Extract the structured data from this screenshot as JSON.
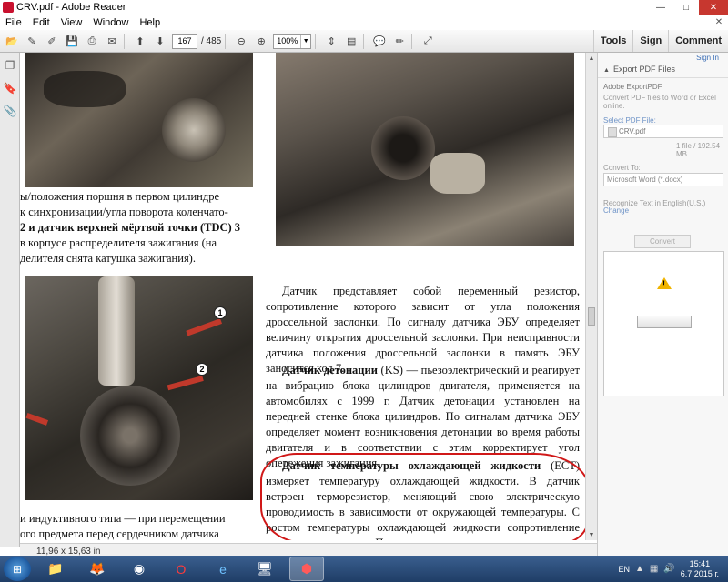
{
  "window": {
    "title": "CRV.pdf - Adobe Reader",
    "controls": {
      "minimize": "—",
      "maximize": "□",
      "close": "✕"
    }
  },
  "menu": {
    "items": [
      "File",
      "Edit",
      "View",
      "Window",
      "Help"
    ],
    "close_doc": "✕"
  },
  "toolbar": {
    "page_current": "167",
    "page_total": "/ 485",
    "zoom": "100%",
    "tools_label": "Tools",
    "sign_label": "Sign",
    "comment_label": "Comment"
  },
  "document": {
    "left_text_top": [
      "ы/положения поршня в первом цилиндре",
      "к синхронизации/угла поворота коленчато-",
      "2 и датчик верхней мёртвой точки (TDC) 3",
      "в корпусе распределителя зажигания (на",
      "делителя снята катушка зажигания)."
    ],
    "callout_1": "1",
    "callout_2": "2",
    "left_text_bottom": [
      "и индуктивного типа — при перемещении",
      "ого предмета перед сердечником датчика"
    ],
    "right_paragraphs": [
      "Датчик представляет собой переменный резистор, сопротивление которого зависит от угла положения дроссельной заслонки. По сигналу датчика ЭБУ определяет величину открытия дроссельной заслонки. При неисправности датчика положения дроссельной заслонки в память ЭБУ заносится код 7.",
      "Датчик детонации (KS) — пьезоэлектрический и реагирует на вибрацию блока цилиндров двигателя, применяется на автомобилях с 1999 г. Датчик детонации установлен на передней стенке блока цилиндров. По сигналам датчика ЭБУ определяет момент возникновения детонации во время работы двигателя и в соответствии с этим корректирует угол опережения зажигания.",
      "Датчик температуры охлаждающей жидкости (ECT) измеряет температуру охлаждающей жидкости. В датчик встроен терморезистор, меняющий свою электрическую проводимость в зависимости от окружающей температуры. С ростом температуры охлаждающей жидкости сопротивление датчика уменьшается. Полученные данные ис-"
    ],
    "ks_bold": "Датчик детонации",
    "ks_rest": " (KS) — пьезоэлектрический и реагирует на вибрацию блока цилиндров двигателя, применяется на автомобилях с 1999 г. Датчик детонации установлен на передней стенке блока цилиндров. По сигналам датчика ЭБУ определяет момент возникновения детонации во время работы двигателя и в соответствии с этим корректирует угол опережения зажигания.",
    "ect_bold": "Датчик температуры охлаждающей жидкости",
    "ect_rest": " (ECT) измеряет температуру охлаждающей жидкости. В датчик встроен терморезистор, меняющий свою электрическую проводимость в зависимости от окружающей температуры. С ростом температуры охлаждающей жидкости сопротивление датчика уменьшается. Полученные данные ис-"
  },
  "status": {
    "dimensions": "11,96 x 15,63 in"
  },
  "right_panel": {
    "sign_in": "Sign In",
    "header": "Export PDF Files",
    "service": "Adobe ExportPDF",
    "description": "Convert PDF files to Word or Excel online.",
    "select_label": "Select PDF File:",
    "file_name": "CRV.pdf",
    "file_info": "1 file / 192.54 MB",
    "convert_to_label": "Convert To:",
    "convert_to_value": "Microsoft Word (*.docx)",
    "recognize_text": "Recognize Text in English(U.S.)",
    "change_link": "Change",
    "convert_button": "Convert"
  },
  "taskbar": {
    "lang": "EN",
    "time": "15:41",
    "date": "6.7.2015 г."
  },
  "colors": {
    "annotation_red": "#d01818",
    "close_red": "#c7372f",
    "taskbar_blue": "#1f3d66",
    "link_blue": "#3d6fb6"
  }
}
